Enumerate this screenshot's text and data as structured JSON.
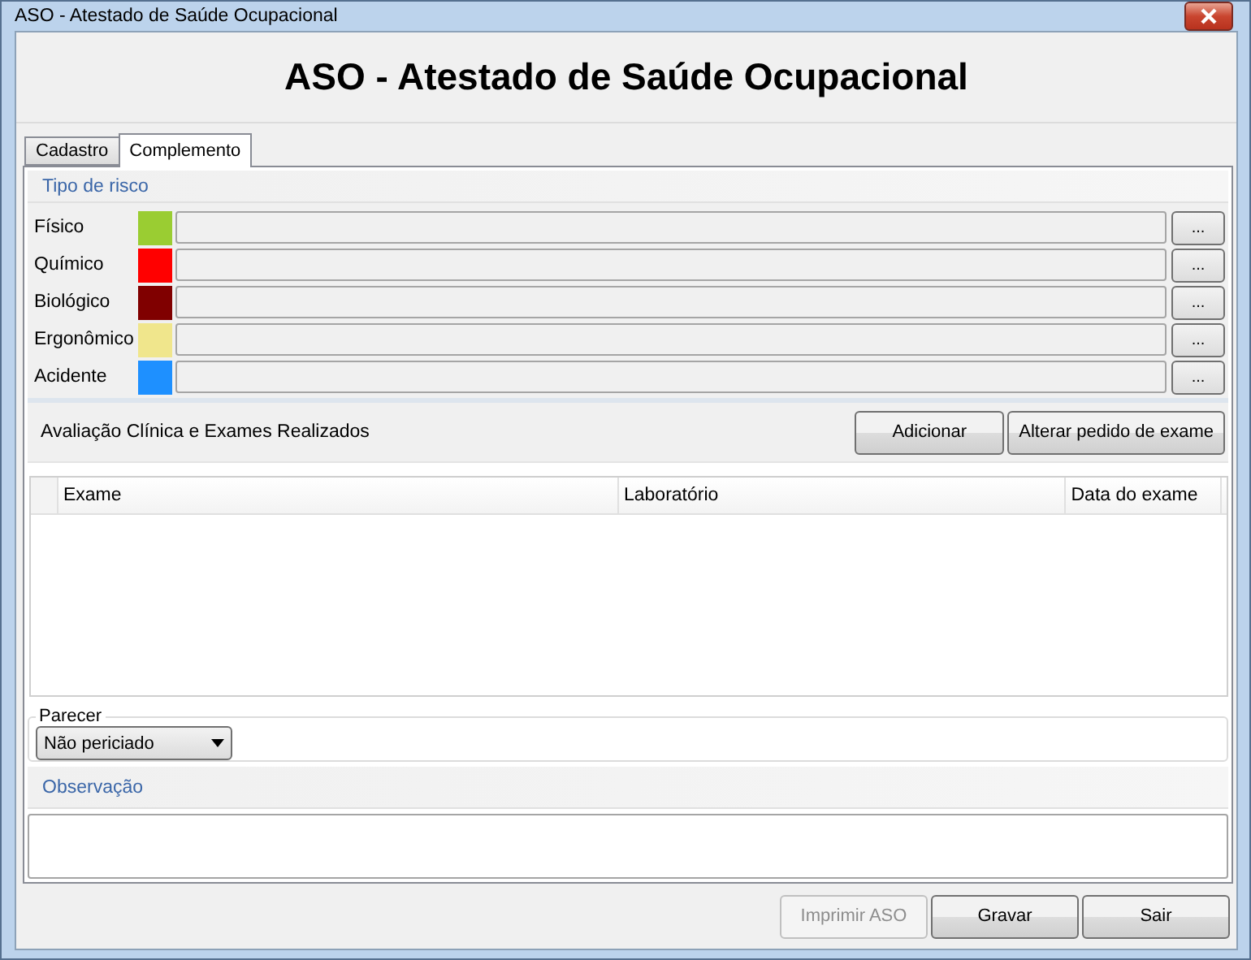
{
  "window": {
    "title": "ASO - Atestado de Saúde Ocupacional"
  },
  "header": "ASO - Atestado de Saúde Ocupacional",
  "tabs": [
    {
      "label": "Cadastro",
      "selected": false
    },
    {
      "label": "Complemento",
      "selected": true
    }
  ],
  "risk_section": {
    "title": "Tipo de risco",
    "browse_label": "...",
    "risks": [
      {
        "label": "Físico",
        "color": "#9acd32"
      },
      {
        "label": "Químico",
        "color": "#ff0000"
      },
      {
        "label": "Biológico",
        "color": "#800000"
      },
      {
        "label": "Ergonômico",
        "color": "#f0e68c"
      },
      {
        "label": "Acidente",
        "color": "#1e90ff"
      }
    ]
  },
  "exams": {
    "title": "Avaliação Clínica e Exames Realizados",
    "buttons": [
      {
        "label": "Adicionar"
      },
      {
        "label": "Alterar pedido de exame"
      }
    ],
    "columns": [
      "Exame",
      "Laboratório",
      "Data do exame"
    ]
  },
  "parecer": {
    "label": "Parecer",
    "value": "Não periciado"
  },
  "observacao": {
    "title": "Observação"
  },
  "footer_buttons": [
    {
      "label": "Imprimir ASO",
      "disabled": true
    },
    {
      "label": "Gravar",
      "disabled": false
    },
    {
      "label": "Sair",
      "disabled": false
    }
  ]
}
